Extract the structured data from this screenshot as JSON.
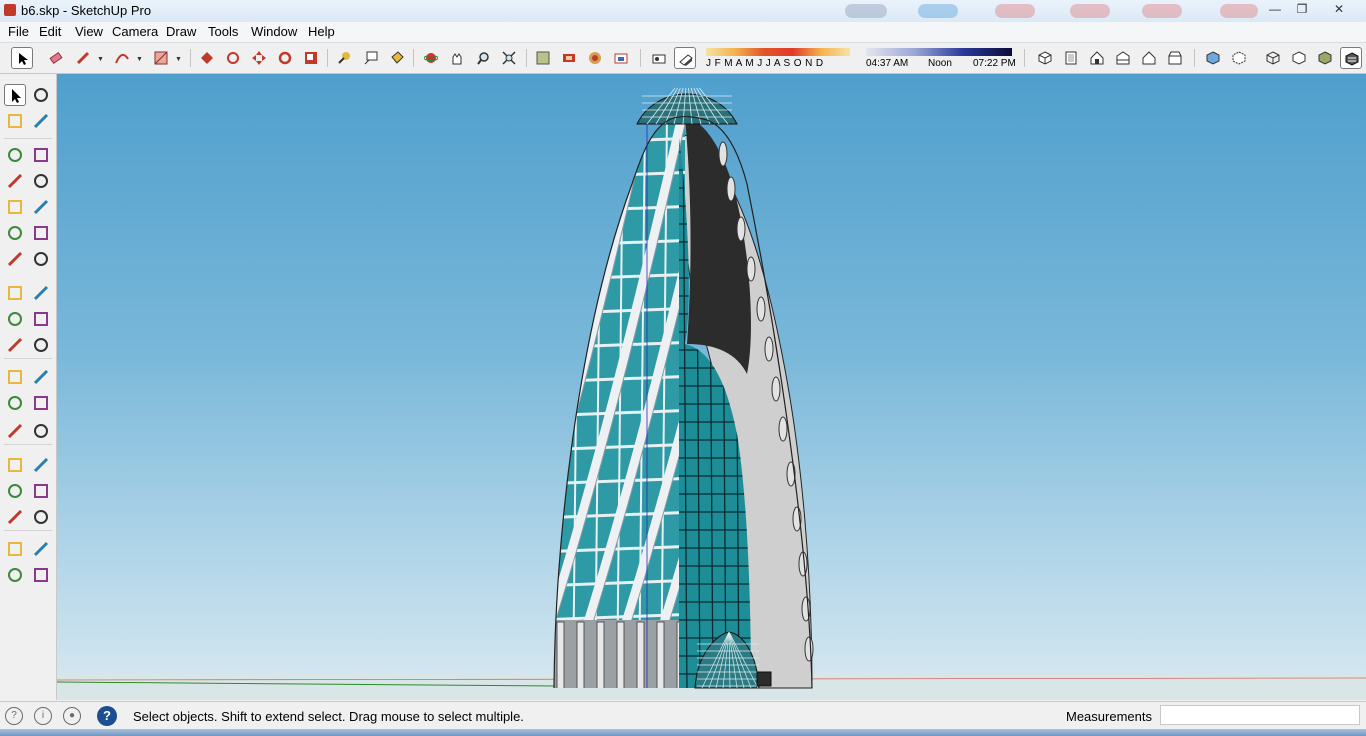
{
  "window": {
    "title": "b6.skp - SketchUp Pro",
    "controls": [
      "minimize-icon",
      "restore-icon",
      "close-icon"
    ]
  },
  "menu": [
    "File",
    "Edit",
    "View",
    "Camera",
    "Draw",
    "Tools",
    "Window",
    "Help"
  ],
  "toolbar": {
    "icons": [
      "select-icon",
      "eraser-icon",
      "pencil-icon",
      "arc-icon",
      "rectangle-icon",
      "push-pull-icon",
      "follow-me-icon",
      "move-icon",
      "rotate-icon",
      "scale-icon",
      "tape-measure-icon",
      "text-icon",
      "paint-bucket-icon",
      "orbit-icon",
      "pan-icon",
      "zoom-icon",
      "zoom-extents-icon",
      "components-icon",
      "materials-icon",
      "styles-icon",
      "3d-warehouse-icon",
      "xray-icon",
      "shadows-icon",
      "iso-view-icon",
      "top-view-icon",
      "front-view-icon",
      "right-view-icon",
      "back-view-icon",
      "left-view-icon",
      "xray-style-icon",
      "back-edges-icon",
      "wireframe-icon",
      "hidden-line-icon",
      "shaded-icon",
      "shaded-textures-icon"
    ],
    "months": "J F M A M J J A S O N D",
    "time_start": "04:37 AM",
    "time_noon": "Noon",
    "time_end": "07:22 PM",
    "shadow_months_color": "#f3b24e",
    "shadow_time_color": "#2a3a9a"
  },
  "palette": {
    "icons": [
      "select-icon",
      "component-icon",
      "paint-bucket-icon",
      "eraser-icon",
      "line-icon",
      "freehand-icon",
      "rectangle-icon",
      "rotated-rectangle-icon",
      "circle-icon",
      "polygon-icon",
      "arc-icon",
      "two-point-arc-icon",
      "three-point-arc-icon",
      "pie-icon",
      "move-icon",
      "push-pull-icon",
      "rotate-icon",
      "follow-me-icon",
      "scale-icon",
      "offset-icon",
      "tape-measure-icon",
      "dimension-icon",
      "protractor-icon",
      "text-icon",
      "axes-icon",
      "3d-text-icon",
      "orbit-icon",
      "pan-icon",
      "zoom-icon",
      "zoom-window-icon",
      "zoom-extents-icon",
      "previous-view-icon",
      "position-camera-icon",
      "look-around-icon",
      "walk-icon",
      "section-plane-icon"
    ]
  },
  "status": {
    "icons": [
      "geo-location-icon",
      "credits-icon",
      "user-icon",
      "help-icon"
    ],
    "message": "Select objects. Shift to extend select. Drag mouse to select multiple.",
    "measurements_label": "Measurements",
    "measurements_value": ""
  },
  "colors": {
    "sky_top": "#4f9fcd",
    "sky_bottom": "#d9e9f1",
    "glass": "#2e9aa5",
    "tube": "#e9ecef"
  }
}
